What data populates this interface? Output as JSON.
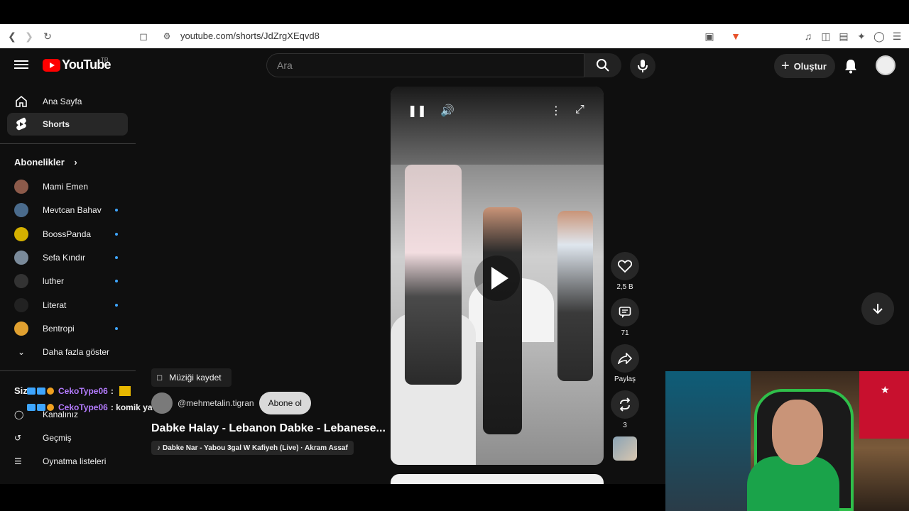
{
  "browser": {
    "url": "youtube.com/shorts/JdZrgXEqvd8"
  },
  "header": {
    "logo_text": "YouTube",
    "logo_region": "TR",
    "search_placeholder": "Ara",
    "create_label": "Oluştur"
  },
  "sidebar": {
    "home": "Ana Sayfa",
    "shorts": "Shorts",
    "subscriptions_title": "Abonelikler",
    "subscriptions": [
      {
        "name": "Mami Emen",
        "dot": false,
        "color": "#8c5a4a"
      },
      {
        "name": "Mevtcan Bahav",
        "dot": true,
        "color": "#4a6b8c"
      },
      {
        "name": "BoossPanda",
        "dot": true,
        "color": "#d4b000"
      },
      {
        "name": "Sefa Kındır",
        "dot": true,
        "color": "#7a8a9a"
      },
      {
        "name": "luther",
        "dot": true,
        "color": "#333333"
      },
      {
        "name": "Literat",
        "dot": true,
        "color": "#222222"
      },
      {
        "name": "Bentropi",
        "dot": true,
        "color": "#e0a030"
      }
    ],
    "show_more": "Daha fazla göster",
    "you_title": "Siz",
    "channel": "Kanalınız",
    "history": "Geçmiş",
    "playlists": "Oynatma listeleri"
  },
  "short": {
    "save_music": "Müziği kaydet",
    "channel_handle": "@mehmetalin.tigran",
    "subscribe_label": "Abone ol",
    "title": "Dabke Halay - Lebanon Dabke - Lebanese...",
    "music": "Dabke Nar - Yabou 3gal W Kafiyeh (Live) · Akram Assaf",
    "likes": "2,5 B",
    "comments": "71",
    "share_label": "Paylaş",
    "remix_count": "3"
  },
  "chat": [
    {
      "user": "CekoType06",
      "message": ":"
    },
    {
      "user": "CekoType06",
      "message": ": komik ya"
    }
  ]
}
